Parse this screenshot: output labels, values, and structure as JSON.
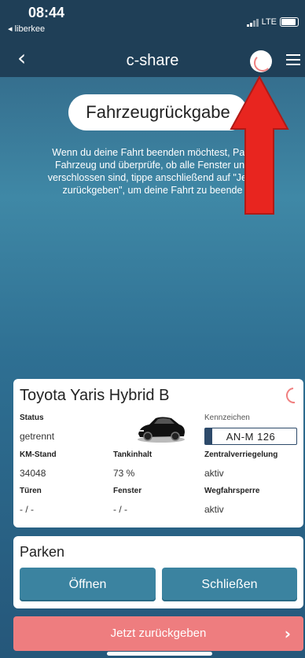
{
  "status_bar": {
    "time": "08:44",
    "back_app": "◂ liberkee",
    "network": "LTE"
  },
  "nav": {
    "title": "c-share",
    "back_icon": "chevron-left-icon",
    "menu_icon": "hamburger-menu-icon"
  },
  "page": {
    "title": "Fahrzeugrückgabe",
    "instructions": "Wenn du deine Fahrt beenden möchtest, Park Fahrzeug und überprüfe, ob alle Fenster und verschlossen sind, tippe anschließend auf \"Jetzt zurückgeben\", um deine Fahrt zu beende"
  },
  "vehicle": {
    "name": "Toyota Yaris Hybrid B",
    "status_label": "Status",
    "status_value": "getrennt",
    "plate_label": "Kennzeichen",
    "plate_value": "AN-M 126",
    "km_label": "KM-Stand",
    "km_value": "34048",
    "tank_label": "Tankinhalt",
    "tank_value": "73 %",
    "central_lock_label": "Zentralverriegelung",
    "central_lock_value": "aktiv",
    "doors_label": "Türen",
    "doors_value": "- / -",
    "windows_label": "Fenster",
    "windows_value": "- / -",
    "immobilizer_label": "Wegfahrsperre",
    "immobilizer_value": "aktiv"
  },
  "parking": {
    "title": "Parken",
    "open_label": "Öffnen",
    "close_label": "Schließen"
  },
  "return_button": {
    "label": "Jetzt zurückgeben",
    "chevron": "›"
  },
  "colors": {
    "header_bg": "#1f3f57",
    "park_button": "#3b83a0",
    "return_button": "#ee7d7f",
    "annotation_arrow": "#e8251f"
  }
}
